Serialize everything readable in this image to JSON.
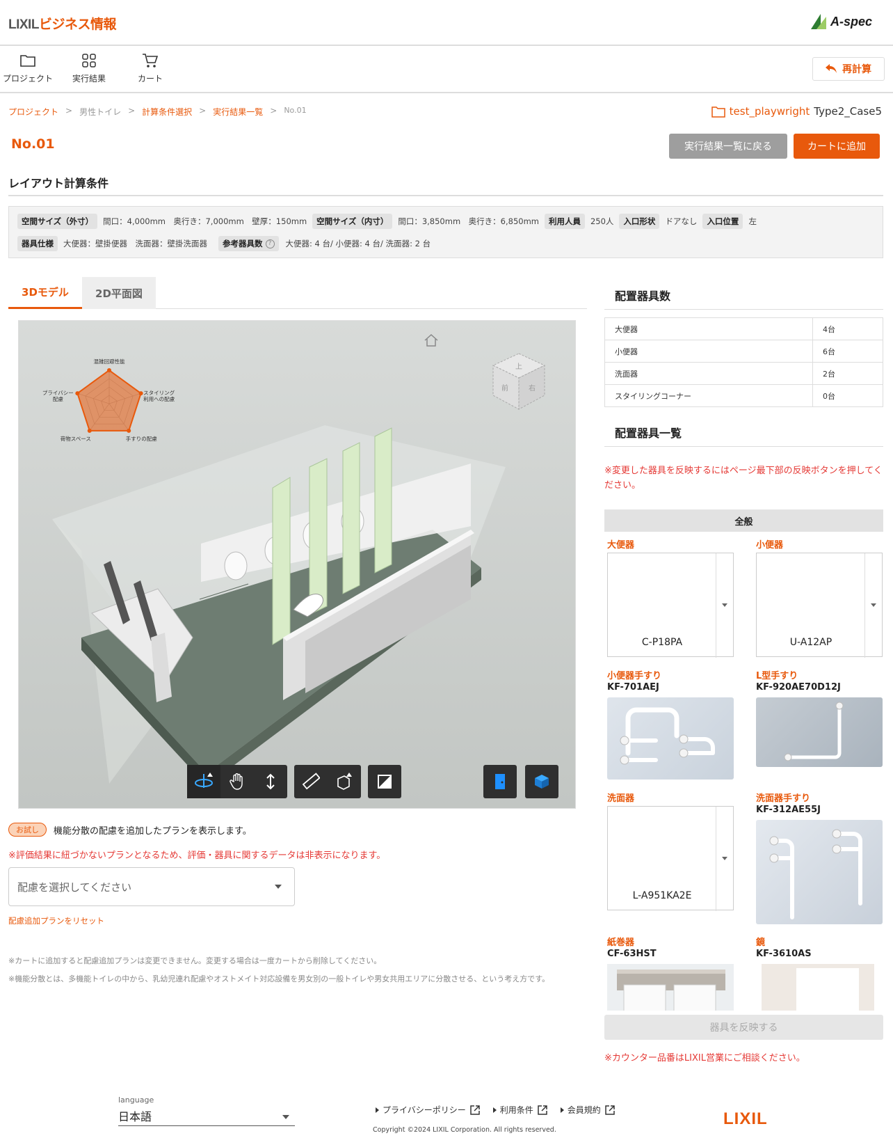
{
  "header": {
    "brand_lixil": "LIXIL",
    "brand_biz": "ビジネス情報",
    "aspec": "A-spec"
  },
  "toolbar": {
    "items": [
      {
        "label": "プロジェクト"
      },
      {
        "label": "実行結果"
      },
      {
        "label": "カート"
      }
    ],
    "recalc_label": "再計算"
  },
  "breadcrumb": {
    "items": [
      "プロジェクト",
      "男性トイレ",
      "計算条件選択",
      "実行結果一覧",
      "No.01"
    ],
    "sep": ">"
  },
  "project": {
    "name": "test_playwright",
    "case": "Type2_Case5"
  },
  "page": {
    "title": "No.01",
    "back_label": "実行結果一覧に戻る",
    "cart_label": "カートに追加"
  },
  "conditions": {
    "heading": "レイアウト計算条件",
    "outer_label": "空間サイズ（外寸）",
    "outer_value": "間口：4,000mm　奥行き：7,000mm　壁厚：150mm",
    "inner_label": "空間サイズ（内寸）",
    "inner_value": "間口：3,850mm　奥行き：6,850mm",
    "users_label": "利用人員",
    "users_value": "250人",
    "entrance_shape_label": "入口形状",
    "entrance_shape_value": "ドアなし",
    "entrance_pos_label": "入口位置",
    "entrance_pos_value": "左",
    "spec_label": "器具仕様",
    "spec_value": "大便器：壁掛便器　洗面器：壁掛洗面器",
    "ref_label": "参考器具数",
    "ref_value": "大便器: 4 台/ 小便器: 4 台/ 洗面器: 2 台"
  },
  "tabs": [
    {
      "label": "3Dモデル",
      "active": true
    },
    {
      "label": "2D平面図",
      "active": false
    }
  ],
  "radar": {
    "labels": [
      "混雑回避性能",
      "スタイリング\n利用への配慮",
      "手すりの配慮",
      "荷物スペース",
      "プライバシー\n配慮"
    ],
    "values": [
      1,
      1,
      1,
      1,
      1
    ],
    "color": "#e8590c"
  },
  "viewcube": {
    "faces": [
      "上",
      "前",
      "右"
    ]
  },
  "trial": {
    "badge": "お試し",
    "text": "機能分散の配慮を追加したプランを表示します。",
    "warning": "※評価結果に紐づかないプランとなるため、評価・器具に関するデータは非表示になります。",
    "select_placeholder": "配慮を選択してください",
    "reset_label": "配慮追加プランをリセット",
    "note1": "※カートに追加すると配慮追加プランは変更できません。変更する場合は一度カートから削除してください。",
    "note2": "※機能分散とは、多機能トイレの中から、乳幼児連れ配慮やオストメイト対応設備を男女別の一般トイレや男女共用エリアに分散させる、という考え方です。"
  },
  "fixtures_count": {
    "heading": "配置器具数",
    "rows": [
      {
        "name": "大便器",
        "count": "4台"
      },
      {
        "name": "小便器",
        "count": "6台"
      },
      {
        "name": "洗面器",
        "count": "2台"
      },
      {
        "name": "スタイリングコーナー",
        "count": "0台"
      }
    ]
  },
  "fixtures_list": {
    "heading": "配置器具一覧",
    "notice": "※変更した器具を反映するにはページ最下部の反映ボタンを押してください。",
    "category": "全般",
    "items": [
      {
        "label": "大便器",
        "value": "C-P18PA"
      },
      {
        "label": "小便器",
        "value": "U-A12AP"
      },
      {
        "label": "小便器手すり",
        "code": "KF-701AEJ"
      },
      {
        "label": "L型手すり",
        "code": "KF-920AE70D12J"
      },
      {
        "label": "洗面器",
        "value": "L-A951KA2E"
      },
      {
        "label": "洗面器手すり",
        "code": "KF-312AE55J"
      },
      {
        "label": "紙巻器",
        "code": "CF-63HST"
      },
      {
        "label": "鏡",
        "code": "KF-3610AS"
      }
    ],
    "apply_label": "器具を反映する",
    "counter_note": "※カウンター品番はLIXIL営業にご相談ください。"
  },
  "footer": {
    "language_label": "language",
    "language_value": "日本語",
    "links": [
      "プライバシーポリシー",
      "利用条件",
      "会員規約"
    ],
    "copyright": "Copyright ©2024 LIXIL Corporation. All rights reserved.",
    "logo": "LIXIL"
  },
  "colors": {
    "accent": "#e8590c",
    "viewer_bg": "#cfd3d0",
    "floor": "#6e7d72",
    "partition": "#d9ecc8",
    "toolbar_dark": "#2f2f2f",
    "door_button": "#1e90ff"
  }
}
